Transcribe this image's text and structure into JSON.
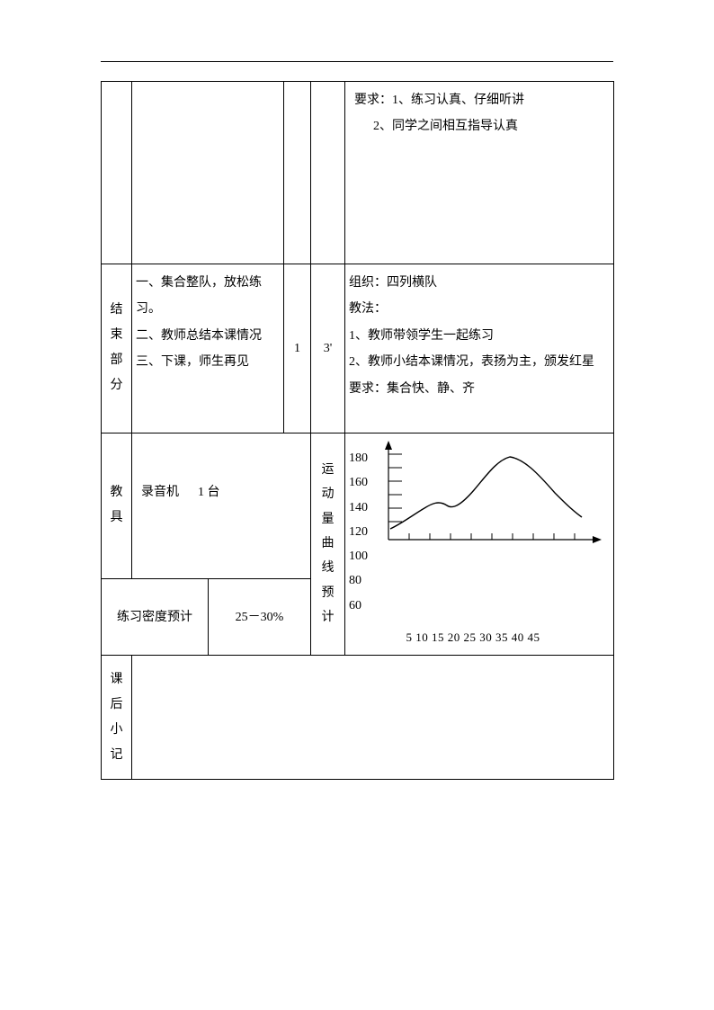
{
  "row1": {
    "req_label": "要求：",
    "req1": "1、练习认真、仔细听讲",
    "req2": "2、同学之间相互指导认真"
  },
  "row2": {
    "side": "结束部分",
    "item1": "一、集合整队，放松练习。",
    "item2": "二、教师总结本课情况",
    "item3": "三、下课，师生再见",
    "times": "1",
    "duration": "3'",
    "org_label": "组织：",
    "org_val": "四列横队",
    "method_label": "教法：",
    "m1": "1、教师带领学生一起练习",
    "m2": "2、教师小结本课情况，表扬为主，颁发红星",
    "req_label": "要求：",
    "req": "集合快、静、齐"
  },
  "row3": {
    "side": "教具",
    "equip": "录音机",
    "equip_qty": "1 台",
    "density_label": "练习密度预计",
    "density_val": "25－30%",
    "curve_label": "运动量曲线预计",
    "xlabels": "5 10 15 20 25 30 35 40 45"
  },
  "row4": {
    "side": "课后小记"
  },
  "chart_data": {
    "type": "line",
    "title": "运动量曲线预计",
    "xlabel": "",
    "ylabel": "",
    "x": [
      5,
      10,
      15,
      20,
      25,
      30,
      35,
      40,
      45
    ],
    "y_ticks": [
      60,
      80,
      100,
      120,
      140,
      160,
      180
    ],
    "ylim": [
      60,
      190
    ],
    "series": [
      {
        "name": "运动量",
        "values": [
          115,
          125,
          135,
          130,
          150,
          168,
          162,
          150,
          130
        ]
      }
    ]
  }
}
